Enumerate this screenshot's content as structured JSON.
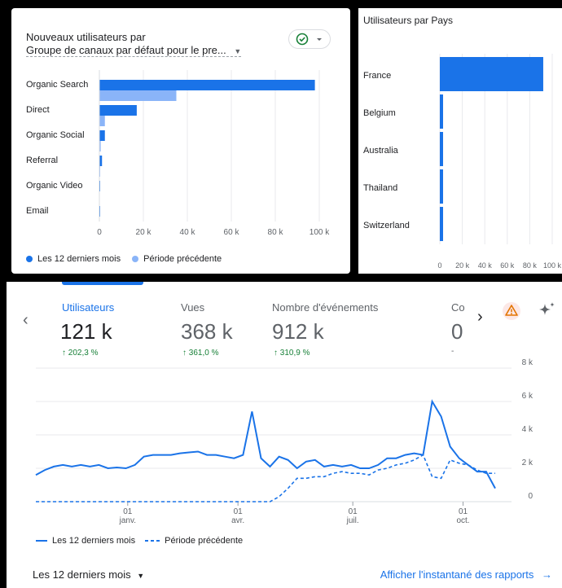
{
  "colors": {
    "current": "#1a73e8",
    "previous": "#8ab4f8",
    "up": "#188038",
    "link": "#1a73e8",
    "warning": "#e37400"
  },
  "channels_card": {
    "title": "Nouveaux utilisateurs par",
    "dimension": "Groupe de canaux par défaut pour le pre...",
    "check_icon": "check-circle-icon"
  },
  "country_card": {
    "title": "Utilisateurs par Pays"
  },
  "overview": {
    "metrics": [
      {
        "label": "Utilisateurs",
        "value": "121 k",
        "delta": "↑ 202,3 %",
        "active": true
      },
      {
        "label": "Vues",
        "value": "368 k",
        "delta": "↑ 361,0 %",
        "active": false
      },
      {
        "label": "Nombre d'événements",
        "value": "912 k",
        "delta": "↑ 310,9 %",
        "active": false
      },
      {
        "label": "Co",
        "value": "0",
        "delta": "-",
        "active": false
      }
    ],
    "icons": {
      "prev": "chevron-left-icon",
      "next": "chevron-right-icon",
      "warning": "warning-icon",
      "insights": "sparkle-icon"
    },
    "date_range": "Les 12 derniers mois",
    "link": "Afficher l'instantané des rapports"
  },
  "chart_data": [
    {
      "type": "bar",
      "orientation": "horizontal",
      "categories": [
        "Organic Search",
        "Direct",
        "Organic Social",
        "Referral",
        "Organic Video",
        "Email"
      ],
      "series": [
        {
          "name": "Les 12 derniers mois",
          "values": [
            98000,
            17000,
            2500,
            1200,
            100,
            50
          ]
        },
        {
          "name": "Période précédente",
          "values": [
            35000,
            2500,
            600,
            300,
            0,
            0
          ]
        }
      ],
      "xticks": [
        "0",
        "20 k",
        "40 k",
        "60 k",
        "80 k",
        "100 k"
      ],
      "xlim": [
        0,
        100000
      ],
      "legend": "bottom-left"
    },
    {
      "type": "bar",
      "orientation": "horizontal",
      "title": "Utilisateurs par Pays",
      "categories": [
        "France",
        "Belgium",
        "Australia",
        "Thailand",
        "Switzerland"
      ],
      "values": [
        92000,
        2500,
        2000,
        2000,
        2000
      ],
      "xticks": [
        "0",
        "20 k",
        "40 k",
        "60 k",
        "80 k",
        "100 k"
      ],
      "xlim": [
        0,
        100000
      ]
    },
    {
      "type": "line",
      "xticks": [
        {
          "label": [
            "01",
            "janv."
          ],
          "pos": 0.2
        },
        {
          "label": [
            "01",
            "avr."
          ],
          "pos": 0.44
        },
        {
          "label": [
            "01",
            "juil."
          ],
          "pos": 0.69
        },
        {
          "label": [
            "01",
            "oct."
          ],
          "pos": 0.93
        }
      ],
      "yticks": [
        "8 k",
        "6 k",
        "4 k",
        "2 k",
        "0"
      ],
      "ylim": [
        0,
        8000
      ],
      "series": [
        {
          "name": "Les 12 derniers mois",
          "style": "solid",
          "values": [
            1600,
            1900,
            2100,
            2200,
            2100,
            2200,
            2100,
            2200,
            2000,
            2050,
            2000,
            2200,
            2700,
            2800,
            2800,
            2800,
            2900,
            2950,
            3000,
            2800,
            2800,
            2700,
            2600,
            2800,
            5400,
            2600,
            2100,
            2700,
            2500,
            2000,
            2400,
            2500,
            2100,
            2200,
            2100,
            2200,
            2000,
            2000,
            2200,
            2600,
            2600,
            2800,
            2900,
            2800,
            6000,
            5100,
            3300,
            2600,
            2200,
            1800,
            1800,
            800
          ]
        },
        {
          "name": "Période précédente",
          "style": "dashed",
          "values": [
            0,
            0,
            0,
            0,
            0,
            0,
            0,
            0,
            0,
            0,
            0,
            0,
            0,
            0,
            0,
            0,
            0,
            0,
            0,
            0,
            0,
            0,
            0,
            0,
            0,
            0,
            0,
            300,
            800,
            1400,
            1400,
            1500,
            1500,
            1700,
            1800,
            1700,
            1700,
            1600,
            1900,
            2000,
            2200,
            2300,
            2500,
            2800,
            1500,
            1400,
            2500,
            2300,
            2200,
            1900,
            1700,
            1700
          ]
        }
      ],
      "legend": "bottom-left"
    }
  ]
}
